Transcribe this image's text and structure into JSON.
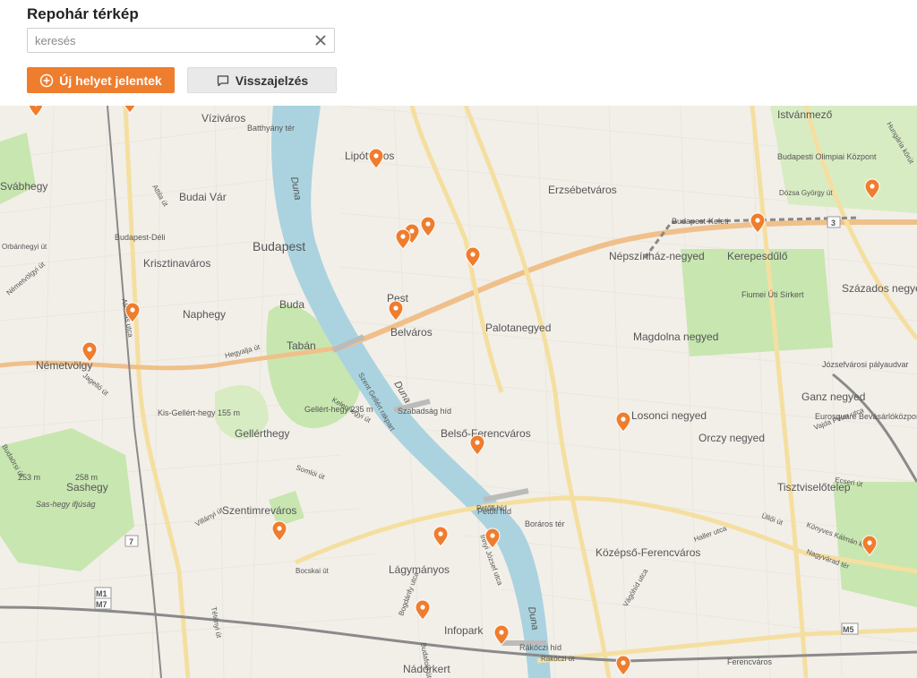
{
  "header": {
    "title": "Repohár térkép",
    "search_placeholder": "keresés",
    "new_place_label": "Új helyet jelentek",
    "feedback_label": "Visszajelzés"
  },
  "colors": {
    "accent": "#ef7d2e",
    "water": "#aad3df",
    "park": "#c8e6b0",
    "marker": "#ef7d2e"
  },
  "map": {
    "district_labels": [
      "Víziváros",
      "Lipótváros",
      "Erzsébetváros",
      "Istvánmező",
      "Budai Vár",
      "Budapest",
      "Krisztinaváros",
      "Naphegy",
      "Buda",
      "Tabán",
      "Pest",
      "Belváros",
      "Palotanegyed",
      "Népszínház-negyed",
      "Magdolna negyed",
      "Kerepesdűlő",
      "Százados negyed",
      "Németvölgy",
      "Gellérthegy",
      "Szentimreváros",
      "Lágymányos",
      "Infopark",
      "Nádorkert",
      "Belső-Ferencváros",
      "Középső-Ferencváros",
      "Losonci negyed",
      "Orczy negyed",
      "Ganz negyed",
      "Tisztviselőtelep",
      "Sashegy",
      "Svábhegy"
    ],
    "poi_labels": [
      "Budapest-Déli",
      "Budapest-Keleti",
      "Batthyány tér",
      "Fiumei Úti Sírkert",
      "Budapesti Olimpiai Központ",
      "Józsefvárosi pályaudvar",
      "Eurosquare Bevásárlóközpont",
      "Szabadság híd",
      "Petőfi híd",
      "Rákóczi híd",
      "Boráros tér",
      "Ferencváros",
      "Kis-Gellért-hegy 155 m",
      "Gellért-hegy 235 m",
      "258 m",
      "253 m",
      "Sas-hegy ifjúság"
    ],
    "river_label": "Duna",
    "street_labels": [
      "Dózsa György út",
      "Attila út",
      "Orbánhegyi út",
      "Németvölgyi út",
      "Alkotás utca",
      "Hegyalja út",
      "Jagelló út",
      "Bocskai út",
      "Somlói út",
      "Villányi út",
      "Tétényi út",
      "Vajda Péter utca",
      "Hungária körút",
      "Haller utca",
      "Könyves Kálmán körút",
      "Vágóhíd utca",
      "Budaörsi út",
      "Üllői út",
      "Nagyvárad tér",
      "Ecseri út",
      "Petőfi híd",
      "Rákóczi út",
      "Bogdánfy utca",
      "Irinyi József utca",
      "Budafoki út",
      "Szent Gellért rakpart",
      "Kelenhegyi út"
    ],
    "route_badges": [
      "3",
      "7",
      "M1",
      "M7",
      "M5"
    ],
    "marker_count": 24
  }
}
